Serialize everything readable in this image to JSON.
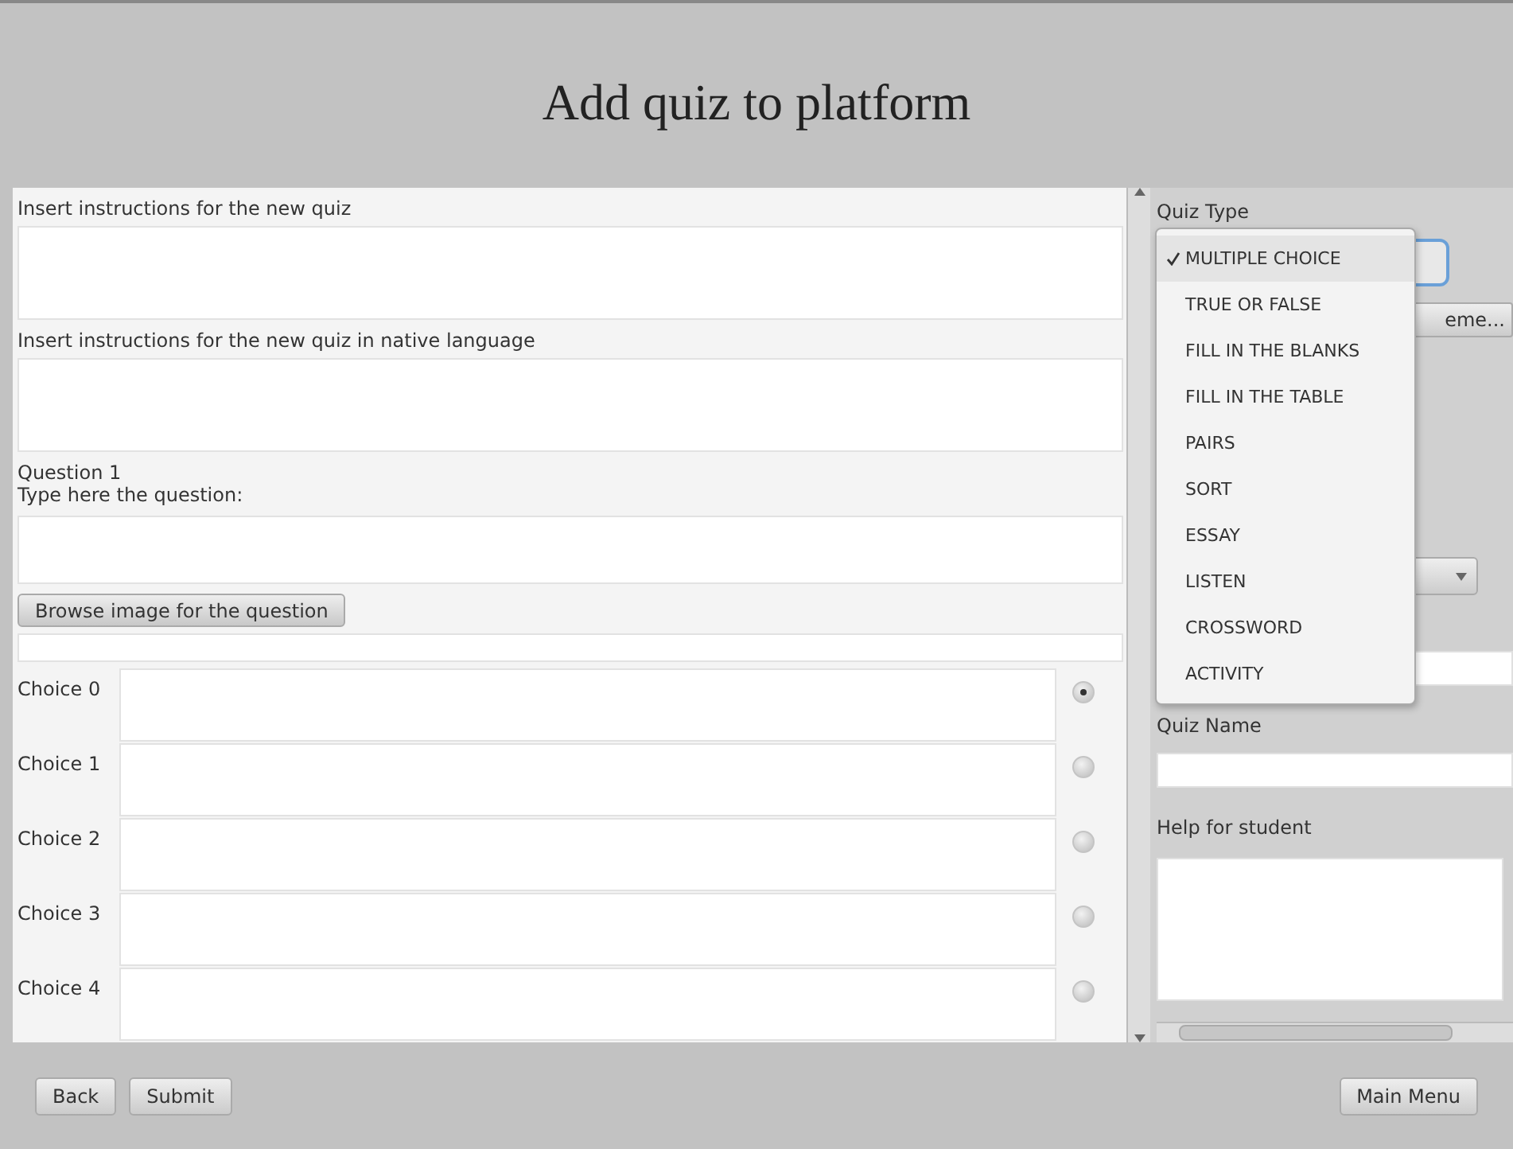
{
  "window": {
    "title": "Add quiz to platform"
  },
  "form": {
    "instructions_label": "Insert instructions for the new quiz",
    "native_instructions_label": "Insert instructions for the new quiz in native language",
    "question_label": "Question 1",
    "question_prompt": "Type here the question:",
    "browse_button": "Browse image for the question",
    "choices": [
      {
        "label": "Choice 0",
        "selected": true
      },
      {
        "label": "Choice 1",
        "selected": false
      },
      {
        "label": "Choice 2",
        "selected": false
      },
      {
        "label": "Choice 3",
        "selected": false
      },
      {
        "label": "Choice 4",
        "selected": false
      }
    ]
  },
  "side": {
    "quiz_type_label": "Quiz Type",
    "theme_button": "eme...",
    "quiz_name_label": "Quiz Name",
    "help_label": "Help for student"
  },
  "quiz_type_menu": [
    {
      "label": "MULTIPLE CHOICE",
      "selected": true
    },
    {
      "label": "TRUE OR FALSE",
      "selected": false
    },
    {
      "label": "FILL IN THE BLANKS",
      "selected": false
    },
    {
      "label": "FILL IN THE TABLE",
      "selected": false
    },
    {
      "label": "PAIRS",
      "selected": false
    },
    {
      "label": "SORT",
      "selected": false
    },
    {
      "label": "ESSAY",
      "selected": false
    },
    {
      "label": "LISTEN",
      "selected": false
    },
    {
      "label": "CROSSWORD",
      "selected": false
    },
    {
      "label": "ACTIVITY",
      "selected": false
    }
  ],
  "footer": {
    "buttons": [
      "Back",
      "Submit"
    ],
    "main_menu": "Main Menu"
  }
}
